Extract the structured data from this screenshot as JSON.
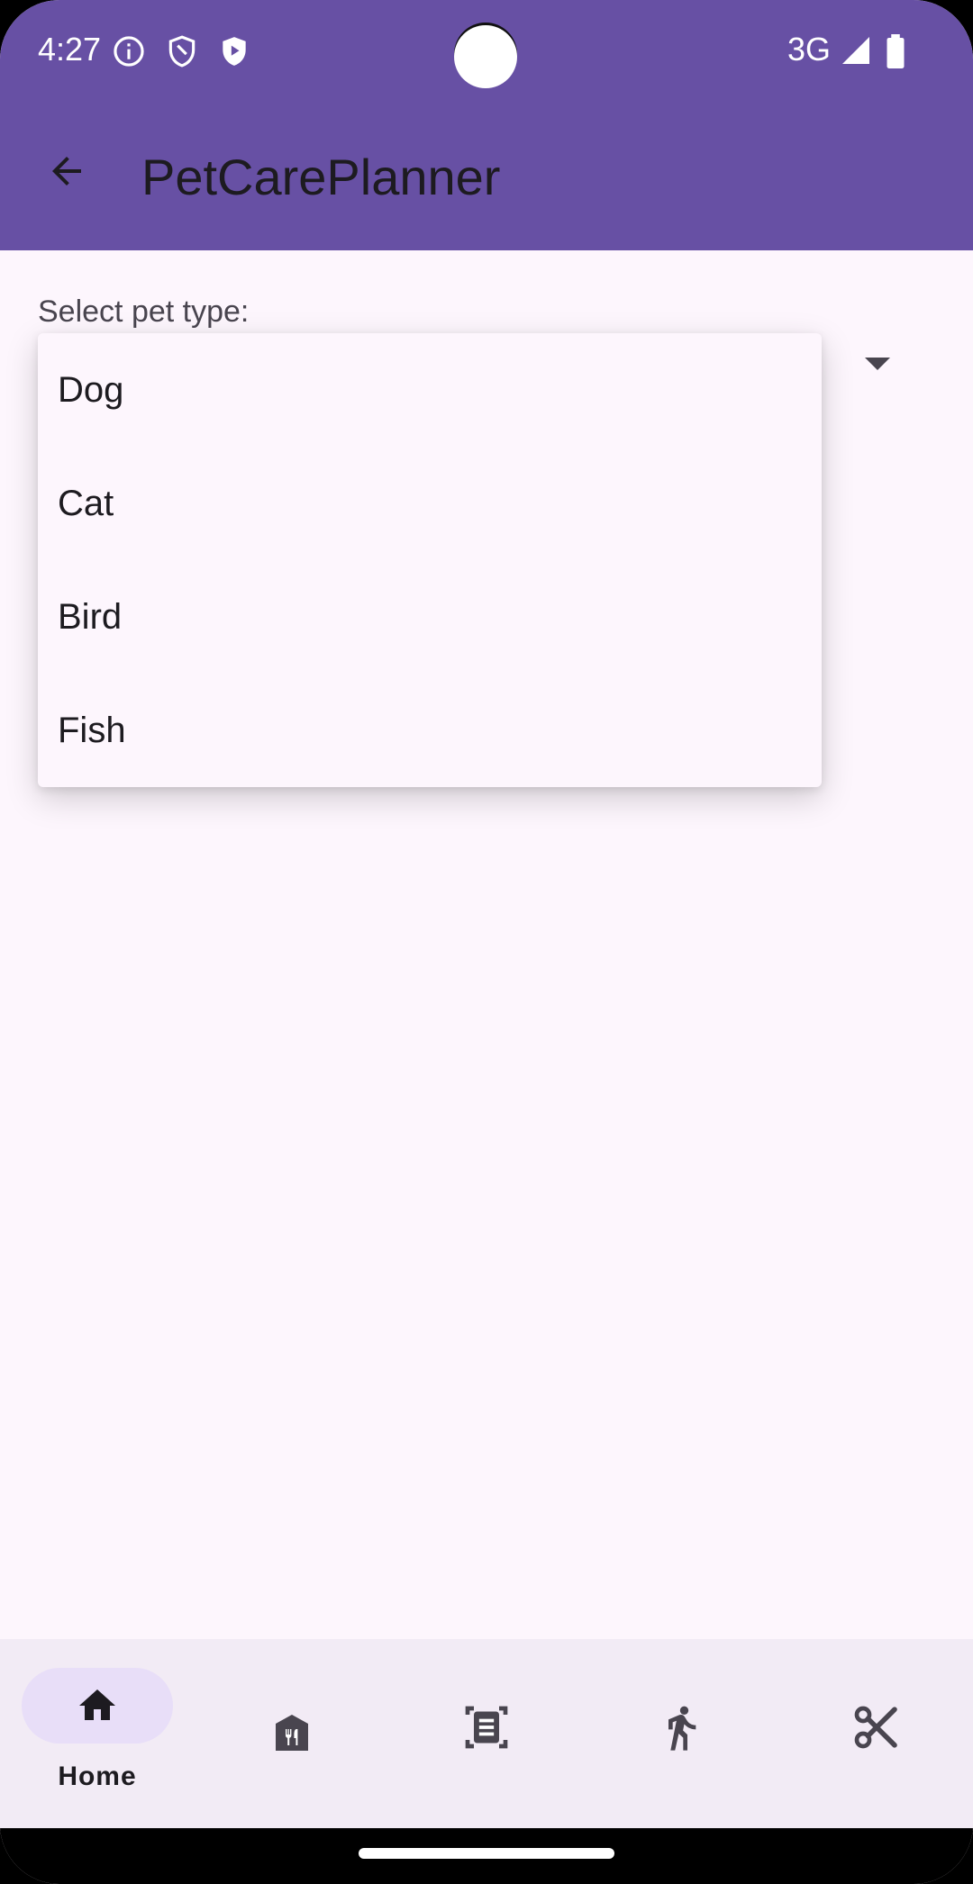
{
  "status_bar": {
    "time": "4:27",
    "network": "3G",
    "icons": [
      "info-icon",
      "shield-icon",
      "play-shield-icon",
      "signal-icon",
      "battery-icon"
    ]
  },
  "app_bar": {
    "title": "PetCarePlanner",
    "back_icon": "arrow-back-icon",
    "color": "#6750a4"
  },
  "form": {
    "select_label": "Select pet type:",
    "dropdown_icon": "arrow-drop-down-icon"
  },
  "menu": {
    "items": [
      "Dog",
      "Cat",
      "Bird",
      "Fish"
    ]
  },
  "bottom_nav": {
    "active_index": 0,
    "items": [
      {
        "label": "Home",
        "icon": "home-icon"
      },
      {
        "label": "",
        "icon": "restaurant-icon"
      },
      {
        "label": "",
        "icon": "document-scanner-icon"
      },
      {
        "label": "",
        "icon": "walk-icon"
      },
      {
        "label": "",
        "icon": "scissors-icon"
      }
    ]
  }
}
